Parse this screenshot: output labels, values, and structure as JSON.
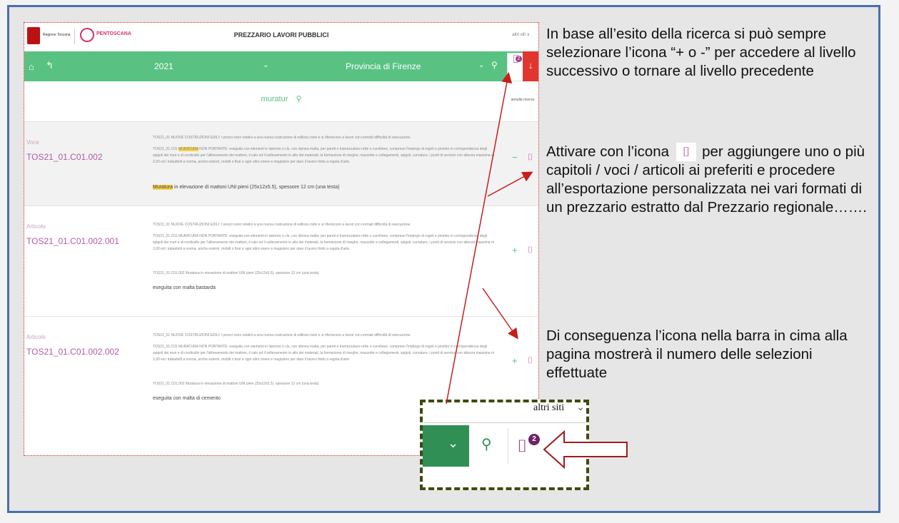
{
  "screenshot": {
    "topbar": {
      "region_label": "Regione Toscana",
      "brand": "PENTOSCANA",
      "title": "PREZZARIO LAVORI PUBBLICI",
      "altri_siti": "altri siti ∨"
    },
    "greenbar": {
      "home_icon": "⌂",
      "back_icon": "↰",
      "year": "2021",
      "province": "Provincia di Firenze",
      "caret": "⌄",
      "search_icon": "⚲",
      "bookmark_icon": "⌷",
      "badge": "2",
      "download_icon": "↓"
    },
    "search": {
      "query": "muratur",
      "search_icon": "⚲",
      "reset": "annulla ricerca"
    },
    "rows": [
      {
        "label": "Voce",
        "code": "TOS21_01.C01.002",
        "line1": "TOS21_01 NUOVE COSTRUZIONI EDILI: I prezzi sono relativi a una nuova costruzione di edilizia civile e si riferiscono a lavori con normali difficoltà di esecuzione.",
        "line2a": "TOS21_01.C01 ",
        "line2hl": "MURATURA",
        "line2b": " NON PORTANTE: eseguita con elementi in laterizio o cls, con idonea malta, per pareti e tramezzature rette o curvilinee, compreso l'impiego di regoli e piombo in corrispondenza degli spigoli dei muri e di cordicelle per l'allineamento dei mattoni, il calo ed il sollevamento in alto dei materiali, la formazione di riseghe, mazzette e collegamenti, spigoli, curvature, i ponti di servizio con altezza massima m 2,00 ed i trabattelli a norma, anche esterni, mobili o fissi e ogni altro onere e magistero per dare il lavoro finito a regola d'arte.",
        "strong_hl": "Muratura",
        "strong_rest": " in elevazione di mattoni UNI pieni (25x12x5.5), spessore 12 cm (una testa)",
        "sign": "−",
        "book_icon": "⌷"
      },
      {
        "label": "Articolo",
        "code": "TOS21_01.C01.002.001",
        "line1": "TOS21_01 NUOVE COSTRUZIONI EDILI: I prezzi sono relativi a una nuova costruzione di edilizia civile e si riferiscono a lavori con normali difficoltà di esecuzione.",
        "line2": "TOS21_01.C01 MURATURA NON PORTANTE: eseguita con elementi in laterizio o cls, con idonea malta, per pareti e tramezzature rette o curvilinee, compreso l'impiego di regoli e piombo in corrispondenza degli spigoli dei muri e di cordicelle per l'allineamento dei mattoni, il calo ed il sollevamento in alto dei materiali, la formazione di riseghe, mazzette e collegamenti, spigoli, curvature, i ponti di servizio con altezza massima m 2,00 ed i trabattelli a norma, anche esterni, mobili o fissi e ogni altro onere e magistero per dare il lavoro finito a regola d'arte.",
        "line3": "TOS21_01.C01.002 Muratura in elevazione di mattoni UNI pieni (25x12x5.5), spessore 12 cm (una testa)",
        "strong": "eseguita con malta bastarda",
        "sign": "+",
        "book_icon": "⌷"
      },
      {
        "label": "Articolo",
        "code": "TOS21_01.C01.002.002",
        "line1": "TOS21_01 NUOVE COSTRUZIONI EDILI: I prezzi sono relativi a una nuova costruzione di edilizia civile e si riferiscono a lavori con normali difficoltà di esecuzione.",
        "line2": "TOS21_01.C01 MURATURA NON PORTANTE: eseguita con elementi in laterizio o cls, con idonea malta, per pareti e tramezzature rette o curvilinee, compreso l'impiego di regoli e piombo in corrispondenza degli spigoli dei muri e di cordicelle per l'allineamento dei mattoni, il calo ed il sollevamento in alto dei materiali, la formazione di riseghe, mazzette e collegamenti, spigoli, curvature, i ponti di servizio con altezza massima m 2,00 ed i trabattelli a norma, anche esterni, mobili o fissi e ogni altro onere e magistero per dare il lavoro finito a regola d'arte.",
        "line3": "TOS21_01.C01.002 Muratura in elevazione di mattoni UNI pieni (25x12x5.5), spessore 12 cm (una testa)",
        "strong": "eseguita con malta di cemento",
        "sign": "+",
        "book_icon": "⌷"
      }
    ]
  },
  "annotations": {
    "para1": "In base all’esito della ricerca si può sempre selezionare l’icona “+ o -” per accedere al livello successivo o tornare al livello precedente",
    "para2_before": "Attivare con l’icona",
    "para2_icon": "⌷",
    "para2_after": "per aggiungere uno o più capitoli / voci / articoli ai preferiti e procedere all’esportazione personalizzata nei vari formati di un prezzario estratto dal Prezzario regionale…….",
    "para3": "Di conseguenza l’icona nella barra in cima alla pagina mostrerà il numero delle selezioni effettuate"
  },
  "zoom": {
    "altri_siti": "altri siti",
    "caret_top": "⌄",
    "caret": "⌄",
    "search_icon": "⚲",
    "bookmark_icon": "⌷",
    "badge": "2"
  },
  "colors": {
    "green": "#59c283",
    "purple": "#b35aa5",
    "red_arrow": "#c81e1e",
    "frame": "#4a6fb0"
  }
}
